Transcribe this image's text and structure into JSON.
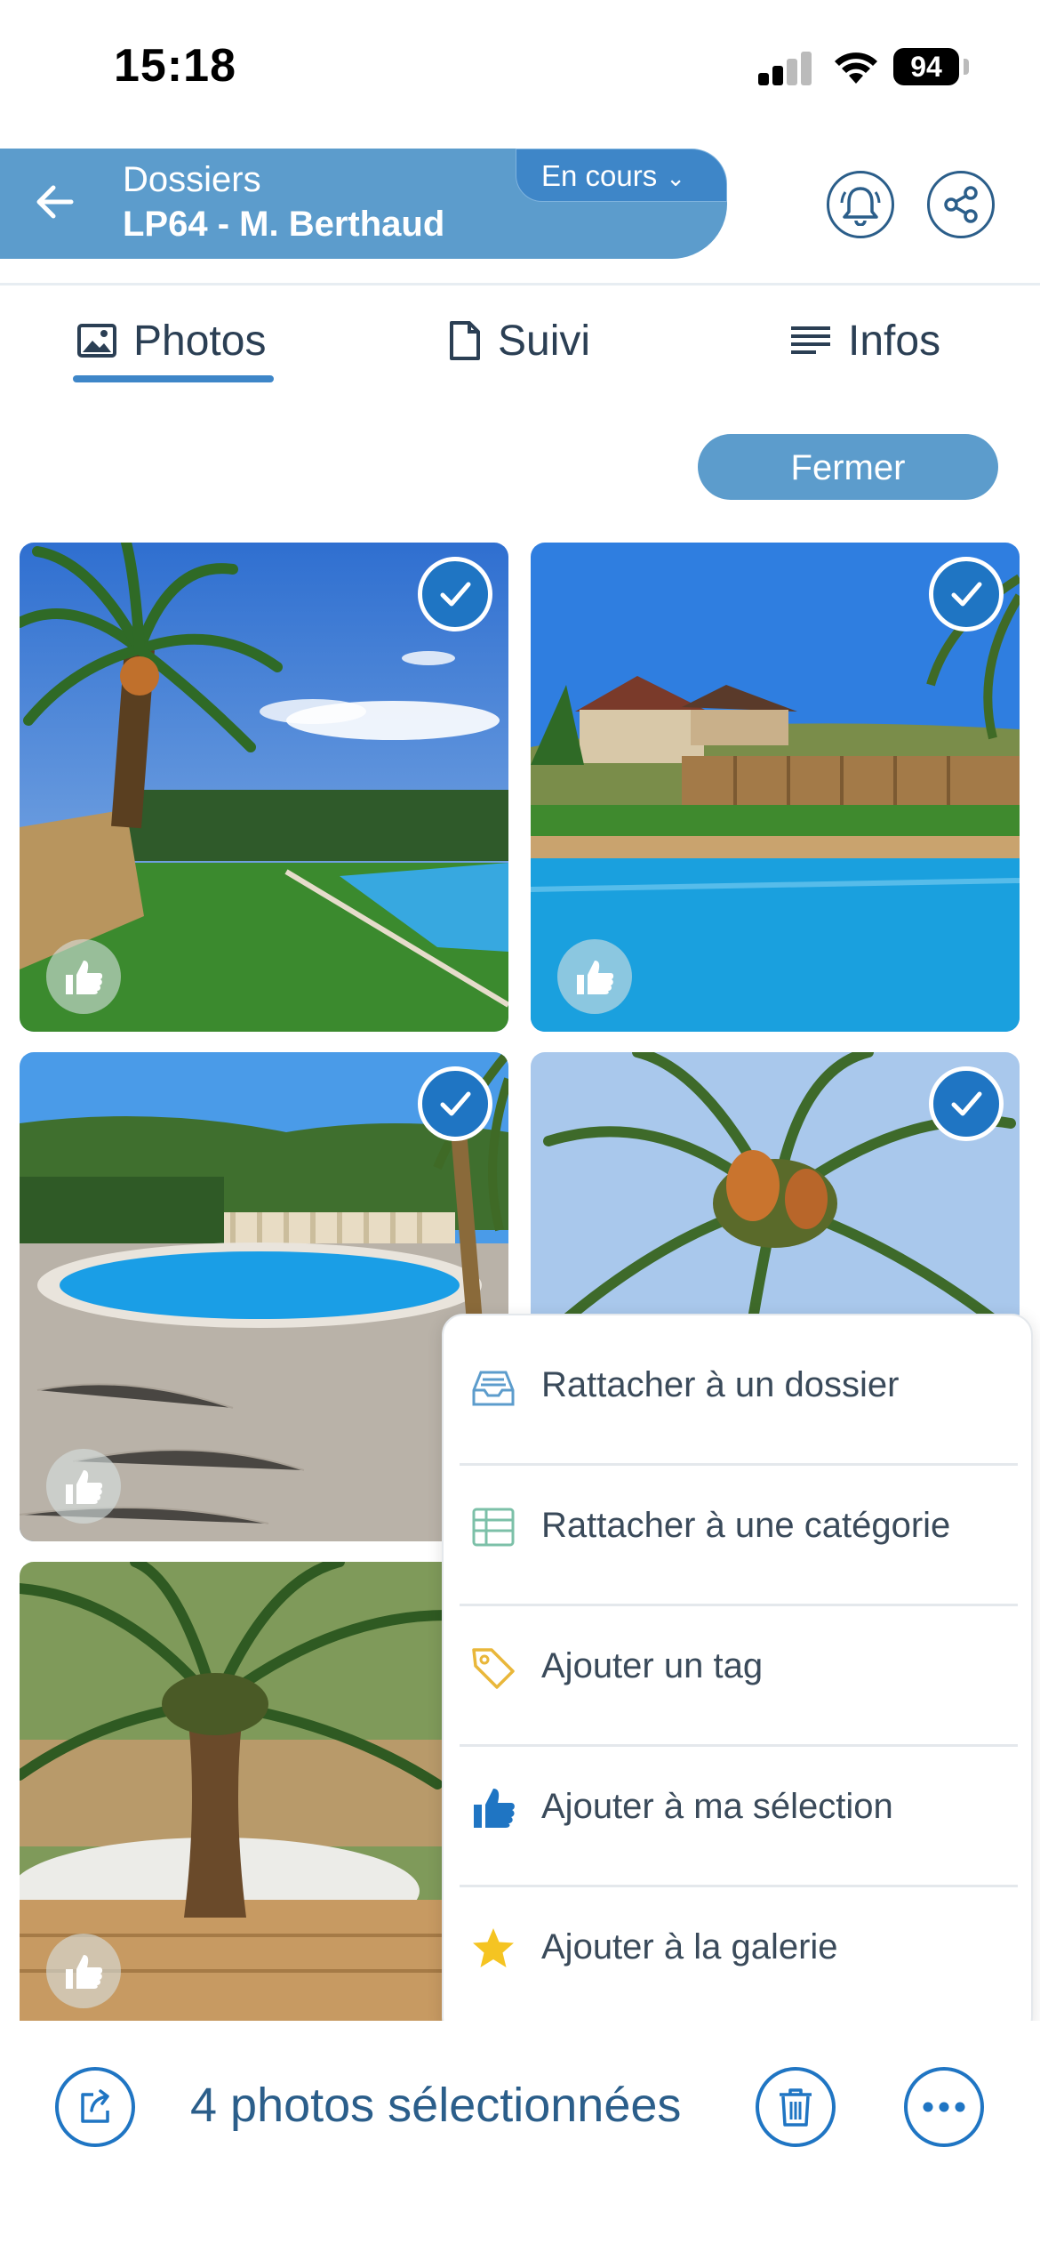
{
  "status_bar": {
    "time": "15:18",
    "battery": "94"
  },
  "header": {
    "section": "Dossiers",
    "title": "LP64 - M. Berthaud",
    "status_chip": "En cours"
  },
  "tabs": [
    {
      "label": "Photos",
      "icon": "image-icon",
      "active": true
    },
    {
      "label": "Suivi",
      "icon": "document-icon",
      "active": false
    },
    {
      "label": "Infos",
      "icon": "lines-icon",
      "active": false
    }
  ],
  "close_button": "Fermer",
  "photos": [
    {
      "subject": "palm-tree-pool-lawn",
      "selected": true,
      "liked": true
    },
    {
      "subject": "pool-house-terrace",
      "selected": true,
      "liked": true
    },
    {
      "subject": "oval-pool-balustrade",
      "selected": true,
      "liked": true
    },
    {
      "subject": "palm-tree-canopy",
      "selected": true,
      "liked": false
    },
    {
      "subject": "palm-trunk-bed",
      "selected": false,
      "liked": true
    }
  ],
  "menu": {
    "items": [
      {
        "label": "Rattacher à un dossier",
        "icon": "inbox-icon"
      },
      {
        "label": "Rattacher à une catégorie",
        "icon": "table-icon"
      },
      {
        "label": "Ajouter un tag",
        "icon": "tag-icon"
      },
      {
        "label": "Ajouter à ma sélection",
        "icon": "thumbs-up-icon"
      },
      {
        "label": "Ajouter à la galerie",
        "icon": "star-icon"
      }
    ]
  },
  "bottom_bar": {
    "selection_label": "4 photos sélectionnées"
  },
  "colors": {
    "primary": "#3e86c8",
    "header": "#5c9ccc",
    "check": "#1f75c3",
    "text": "#2b3f54"
  }
}
